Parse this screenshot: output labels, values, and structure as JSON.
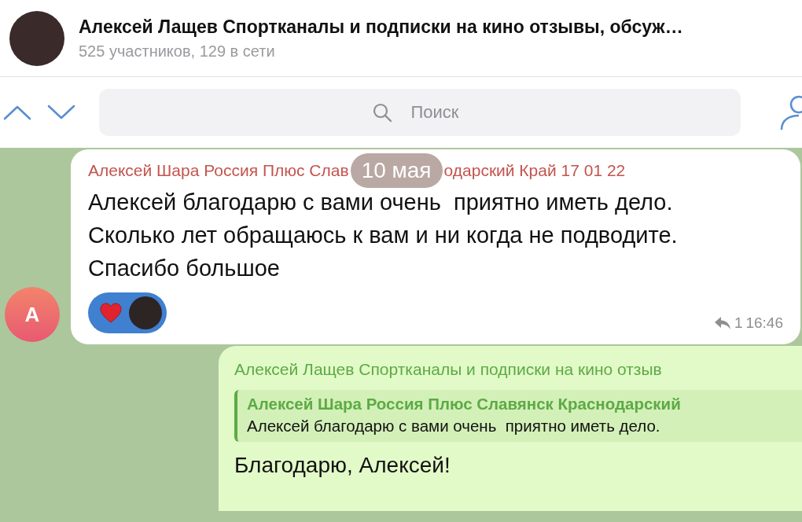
{
  "header": {
    "title": "Алексей Лащев Спортканалы и подписки на кино отзывы, обсуж…",
    "subtitle": "525 участников, 129 в сети"
  },
  "search": {
    "placeholder": "Поиск"
  },
  "date_badge": "10 мая",
  "messages": [
    {
      "kind": "incoming",
      "avatar_letter": "А",
      "sender_parts": [
        "Алексей Шара Россия Плюс Слав",
        "одарский Край 17 01 22"
      ],
      "text": "Алексей благодарю с вами очень  приятно иметь дело. Сколько лет обращаюсь к вам и ни когда не подводите. Спасибо большое",
      "reaction": {
        "selected": true
      },
      "reply_count": "1",
      "time": "16:46"
    },
    {
      "kind": "outgoing",
      "forward_from": "Алексей Лащев Спортканалы и подписки на кино отзыв",
      "quote": {
        "author": "Алексей Шара Россия Плюс Славянск Краснодарский",
        "text": "Алексей благодарю с вами очень  приятно иметь дело."
      },
      "text": "Благодарю, Алексей!"
    }
  ]
}
